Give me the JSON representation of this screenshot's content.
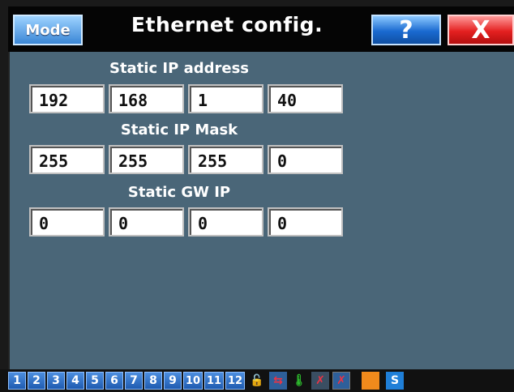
{
  "window": {
    "title": "Ethernet config.",
    "mode_label": "Mode",
    "help_label": "?",
    "close_label": "X"
  },
  "static_ip": {
    "label": "Static IP address",
    "octets": [
      "192",
      "168",
      "1",
      "40"
    ]
  },
  "static_mask": {
    "label": "Static IP Mask",
    "octets": [
      "255",
      "255",
      "255",
      "0"
    ]
  },
  "static_gw": {
    "label": "Static GW IP",
    "octets": [
      "0",
      "0",
      "0",
      "0"
    ]
  },
  "statusbar": {
    "numbers": [
      "1",
      "2",
      "3",
      "4",
      "5",
      "6",
      "7",
      "8",
      "9",
      "10",
      "11",
      "12"
    ],
    "icons": [
      "lock-icon",
      "network-error-icon",
      "thermometer-icon",
      "cable-error-icon",
      "box-error-icon",
      "orange-indicator-icon",
      "s-icon"
    ],
    "s_label": "S"
  },
  "colors": {
    "background": "#4a6678",
    "titlebar": "#050505",
    "accent_blue": "#1f5bb0",
    "close_red": "#e42020"
  }
}
